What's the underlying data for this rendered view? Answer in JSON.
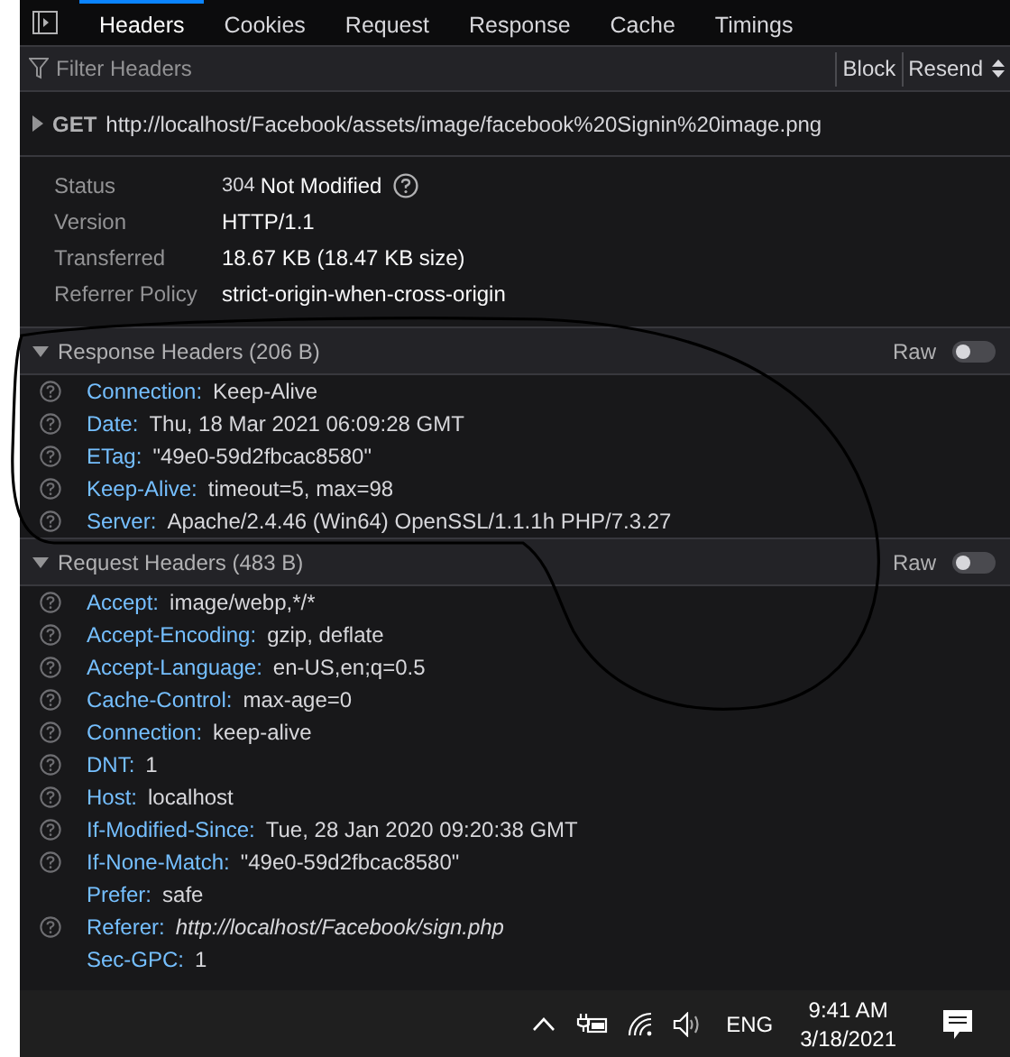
{
  "tabs": [
    {
      "label": "Headers",
      "selected": true
    },
    {
      "label": "Cookies",
      "selected": false
    },
    {
      "label": "Request",
      "selected": false
    },
    {
      "label": "Response",
      "selected": false
    },
    {
      "label": "Cache",
      "selected": false
    },
    {
      "label": "Timings",
      "selected": false
    }
  ],
  "filter": {
    "placeholder": "Filter Headers"
  },
  "toolbar_buttons": [
    {
      "label": "Block",
      "kind": "plain"
    },
    {
      "label": "Resend",
      "kind": "menu"
    }
  ],
  "request": {
    "method": "GET",
    "url": "http://localhost/Facebook/assets/image/facebook%20Signin%20image.png",
    "expanded": false
  },
  "summary": [
    {
      "label": "Status",
      "code": "304",
      "value": "Not Modified",
      "help": true
    },
    {
      "label": "Version",
      "value": "HTTP/1.1",
      "help": false
    },
    {
      "label": "Transferred",
      "value": "18.67 KB (18.47 KB size)",
      "help": false
    },
    {
      "label": "Referrer Policy",
      "value": "strict-origin-when-cross-origin",
      "help": false
    }
  ],
  "sections": [
    {
      "title": "Response Headers (206 B)",
      "expanded": true,
      "raw_label": "Raw",
      "raw_on": false,
      "headers": [
        {
          "name": "Connection:",
          "value": "Keep-Alive",
          "help": true,
          "kind": "text"
        },
        {
          "name": "Date:",
          "value": "Thu, 18 Mar 2021 06:09:28 GMT",
          "help": true,
          "kind": "text"
        },
        {
          "name": "ETag:",
          "value": "\"49e0-59d2fbcac8580\"",
          "help": true,
          "kind": "text"
        },
        {
          "name": "Keep-Alive:",
          "value": "timeout=5, max=98",
          "help": true,
          "kind": "text"
        },
        {
          "name": "Server:",
          "value": "Apache/2.4.46 (Win64) OpenSSL/1.1.1h PHP/7.3.27",
          "help": true,
          "kind": "text"
        }
      ]
    },
    {
      "title": "Request Headers (483 B)",
      "expanded": true,
      "raw_label": "Raw",
      "raw_on": false,
      "headers": [
        {
          "name": "Accept:",
          "value": "image/webp,*/*",
          "help": true,
          "kind": "text"
        },
        {
          "name": "Accept-Encoding:",
          "value": "gzip, deflate",
          "help": true,
          "kind": "text"
        },
        {
          "name": "Accept-Language:",
          "value": "en-US,en;q=0.5",
          "help": true,
          "kind": "text"
        },
        {
          "name": "Cache-Control:",
          "value": "max-age=0",
          "help": true,
          "kind": "text"
        },
        {
          "name": "Connection:",
          "value": "keep-alive",
          "help": true,
          "kind": "text"
        },
        {
          "name": "DNT:",
          "value": "1",
          "help": true,
          "kind": "text"
        },
        {
          "name": "Host:",
          "value": "localhost",
          "help": true,
          "kind": "text"
        },
        {
          "name": "If-Modified-Since:",
          "value": "Tue, 28 Jan 2020 09:20:38 GMT",
          "help": true,
          "kind": "text"
        },
        {
          "name": "If-None-Match:",
          "value": "\"49e0-59d2fbcac8580\"",
          "help": true,
          "kind": "text"
        },
        {
          "name": "Prefer:",
          "value": "safe",
          "help": false,
          "kind": "text"
        },
        {
          "name": "Referer:",
          "value": "http://localhost/Facebook/sign.php",
          "help": true,
          "kind": "link"
        },
        {
          "name": "Sec-GPC:",
          "value": "1",
          "help": false,
          "kind": "text"
        }
      ]
    }
  ],
  "taskbar": {
    "language": "ENG",
    "time": "9:41 AM",
    "date": "3/18/2021"
  }
}
